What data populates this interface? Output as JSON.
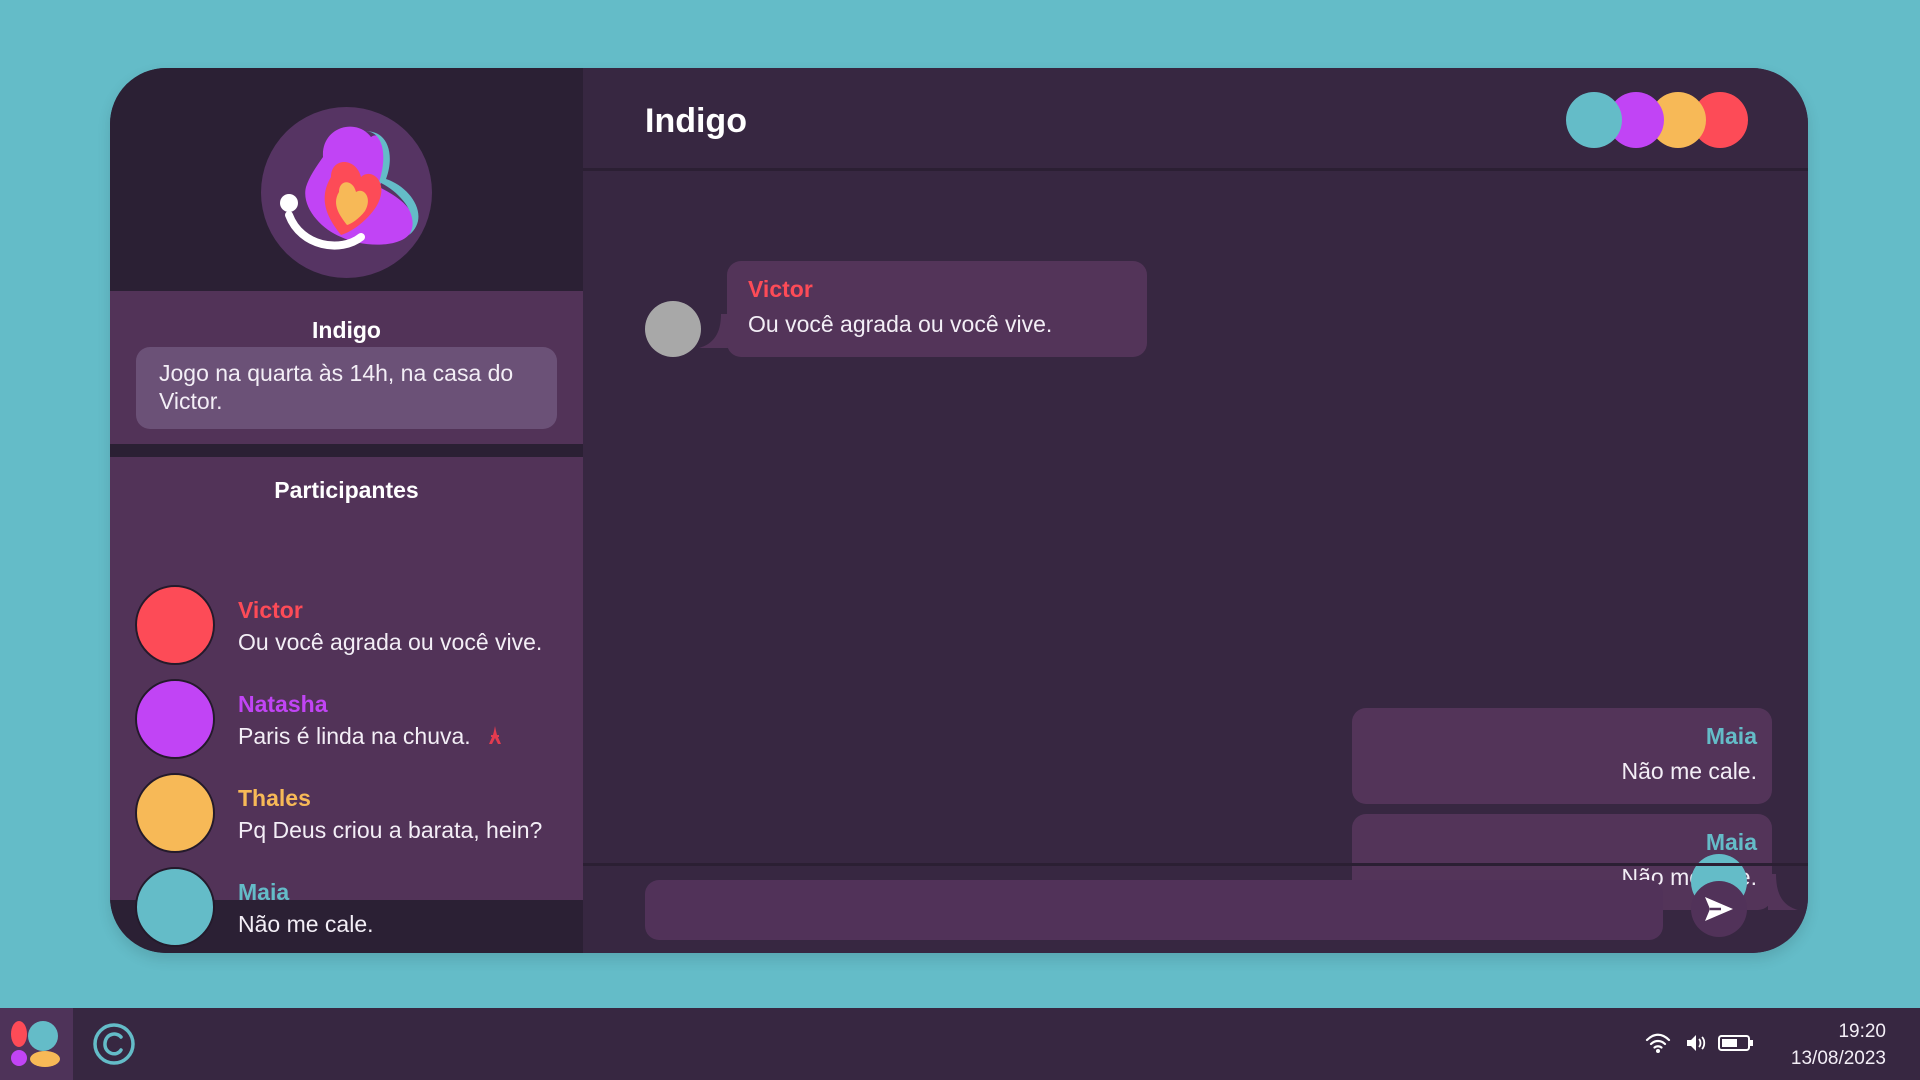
{
  "colors": {
    "desktop_bg": "#64bcc8",
    "victor": "#fd4b57",
    "natasha": "#c144f5",
    "thales": "#f7b957",
    "maia": "#64bcc8",
    "bubble": "#533459",
    "placeholder_avatar": "#a8a8a8"
  },
  "sidebar": {
    "group_name": "Indigo",
    "group_description": "Jogo na quarta às 14h, na casa do Victor.",
    "participants_title": "Participantes",
    "participants": [
      {
        "name": "Victor",
        "status": "Ou você agrada ou você vive.",
        "color": "#fd4b57"
      },
      {
        "name": "Natasha",
        "status": "Paris é linda na chuva.",
        "color": "#c144f5",
        "icon": "eiffel-tower-icon"
      },
      {
        "name": "Thales",
        "status": "Pq Deus criou a barata, hein?",
        "color": "#f7b957"
      },
      {
        "name": "Maia",
        "status": "Não me cale.",
        "color": "#64bcc8"
      }
    ]
  },
  "chat": {
    "title": "Indigo",
    "header_avatars": [
      "#64bcc8",
      "#c144f5",
      "#f7b957",
      "#fd4b57"
    ],
    "messages": [
      {
        "sender": "Victor",
        "text": "Ou você agrada ou você vive.",
        "side": "left",
        "color": "#fd4b57"
      },
      {
        "sender": "Maia",
        "text": "Não me cale.",
        "side": "right",
        "color": "#64bcc8"
      },
      {
        "sender": "Maia",
        "text": "Não me cale.",
        "side": "right",
        "color": "#64bcc8"
      }
    ],
    "composer_placeholder": ""
  },
  "taskbar": {
    "time": "19:20",
    "date": "13/08/2023",
    "tray_icons": [
      "wifi-icon",
      "volume-icon",
      "battery-icon"
    ]
  }
}
